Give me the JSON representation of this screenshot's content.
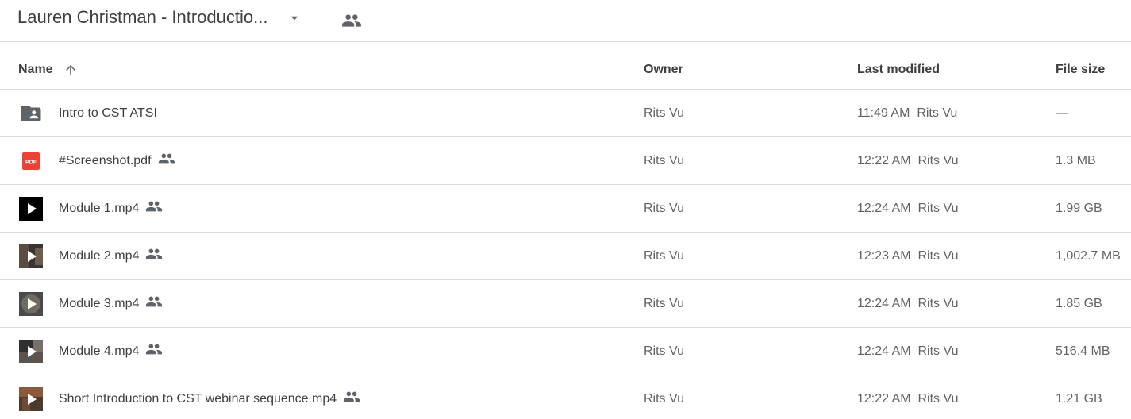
{
  "folder": {
    "title": "Lauren Christman - Introductio...",
    "title_icon": "chevron-down-icon",
    "shared_icon": "people-icon"
  },
  "columns": {
    "name": "Name",
    "owner": "Owner",
    "last_modified": "Last modified",
    "file_size": "File size",
    "sort_icon": "arrow-up-icon"
  },
  "files": [
    {
      "name": "Intro to CST ATSI",
      "type_icon": "shared-folder-icon",
      "shared": false,
      "owner": "Rits Vu",
      "modified_time": "11:49 AM",
      "modified_by": "Rits Vu",
      "size": "—"
    },
    {
      "name": "#Screenshot.pdf",
      "type_icon": "pdf-icon",
      "shared": true,
      "owner": "Rits Vu",
      "modified_time": "12:22 AM",
      "modified_by": "Rits Vu",
      "size": "1.3 MB"
    },
    {
      "name": "Module 1.mp4",
      "type_icon": "video-icon",
      "shared": true,
      "owner": "Rits Vu",
      "modified_time": "12:24 AM",
      "modified_by": "Rits Vu",
      "size": "1.99 GB"
    },
    {
      "name": "Module 2.mp4",
      "type_icon": "video-thumbnail-icon",
      "shared": true,
      "owner": "Rits Vu",
      "modified_time": "12:23 AM",
      "modified_by": "Rits Vu",
      "size": "1,002.7 MB"
    },
    {
      "name": "Module 3.mp4",
      "type_icon": "video-thumbnail-icon",
      "shared": true,
      "owner": "Rits Vu",
      "modified_time": "12:24 AM",
      "modified_by": "Rits Vu",
      "size": "1.85 GB"
    },
    {
      "name": "Module 4.mp4",
      "type_icon": "video-thumbnail-icon",
      "shared": true,
      "owner": "Rits Vu",
      "modified_time": "12:24 AM",
      "modified_by": "Rits Vu",
      "size": "516.4 MB"
    },
    {
      "name": "Short Introduction to CST webinar sequence.mp4",
      "type_icon": "video-thumbnail-icon",
      "shared": true,
      "owner": "Rits Vu",
      "modified_time": "12:22 AM",
      "modified_by": "Rits Vu",
      "size": "1.21 GB"
    }
  ],
  "colors": {
    "pdf_red": "#ea4335",
    "icon_gray": "#5f6368",
    "divider": "#dadce0"
  }
}
